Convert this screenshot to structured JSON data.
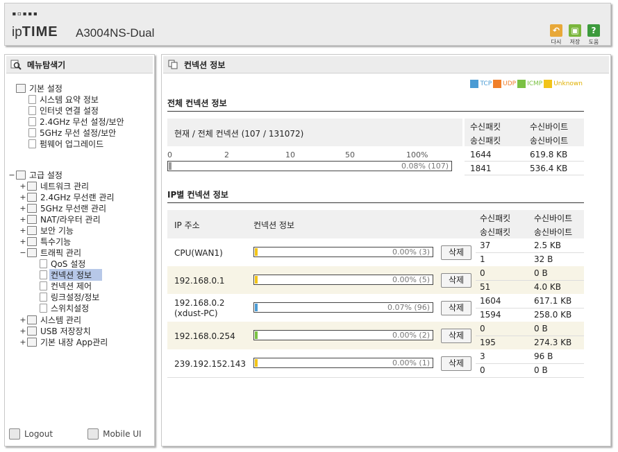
{
  "header": {
    "logo_dots": "▪▫▪▪▪",
    "brand_prefix": "ip",
    "brand_bold": "TIME",
    "model": "A3004NS-Dual",
    "buttons": [
      {
        "label": "다시",
        "icon": "undo-icon",
        "color": "#e8a838",
        "glyph": "↶"
      },
      {
        "label": "저장",
        "icon": "save-icon",
        "color": "#7ab63c",
        "glyph": "▣"
      },
      {
        "label": "도움",
        "icon": "help-icon",
        "color": "#3c9a3c",
        "glyph": "?"
      }
    ]
  },
  "sidebar": {
    "title": "메뉴탐색기",
    "basic": {
      "label": "기본 설정",
      "items": [
        "시스템 요약 정보",
        "인터넷 연결 설정",
        "2.4GHz 무선 설정/보안",
        "5GHz 무선 설정/보안",
        "펌웨어 업그레이드"
      ]
    },
    "advanced": {
      "label": "고급 설정",
      "items": [
        "네트워크 관리",
        "2.4GHz 무선랜 관리",
        "5GHz 무선랜 관리",
        "NAT/라우터 관리",
        "보안 기능",
        "특수기능",
        "트래픽 관리"
      ],
      "traffic_items": [
        "QoS 설정",
        "컨넥션 정보",
        "컨넥션 제어",
        "링크설정/정보",
        "스위치설정"
      ],
      "rest_items": [
        "시스템 관리",
        "USB 저장장치",
        "기본 내장 App관리"
      ]
    },
    "footer": {
      "logout": "Logout",
      "mobile": "Mobile UI"
    }
  },
  "main": {
    "title": "컨넥션 정보",
    "legend": [
      {
        "label": "TCP",
        "color": "#4a9bd4"
      },
      {
        "label": "UDP",
        "color": "#f07f2a"
      },
      {
        "label": "ICMP",
        "color": "#7ac143"
      },
      {
        "label": "Unknown",
        "color": "#f2c418"
      }
    ],
    "total": {
      "section_title": "전체 컨넥션 정보",
      "label": "현재 / 전체 컨넥션 (107 / 131072)",
      "scale": [
        "0",
        "2",
        "10",
        "50",
        "100%"
      ],
      "bar_text": "0.08% (107)",
      "bar_fraction": 0.0008,
      "col_rx_pkt": "수신패킷",
      "col_tx_pkt": "송신패킷",
      "col_rx_byte": "수신바이트",
      "col_tx_byte": "송신바이트",
      "rx_pkt": "1644",
      "rx_byte": "619.8 KB",
      "tx_pkt": "1841",
      "tx_byte": "536.4 KB"
    },
    "by_ip": {
      "section_title": "IP별 컨넥션 정보",
      "col_ip": "IP 주소",
      "col_conn": "컨넥션 정보",
      "col_rx_pkt": "수신패킷",
      "col_tx_pkt": "송신패킷",
      "col_rx_byte": "수신바이트",
      "col_tx_byte": "송신바이트",
      "delete_label": "삭제",
      "rows": [
        {
          "ip": "CPU(WAN1)",
          "sub": "",
          "bar_text": "0.00% (3)",
          "rx_pkt": "37",
          "rx_byte": "2.5 KB",
          "tx_pkt": "1",
          "tx_byte": "32 B",
          "fill": "#f2c418"
        },
        {
          "ip": "192.168.0.1",
          "sub": "",
          "bar_text": "0.00% (5)",
          "rx_pkt": "0",
          "rx_byte": "0 B",
          "tx_pkt": "51",
          "tx_byte": "4.0 KB",
          "fill": "#f2c418"
        },
        {
          "ip": "192.168.0.2",
          "sub": "(xdust-PC)",
          "bar_text": "0.07% (96)",
          "rx_pkt": "1604",
          "rx_byte": "617.1 KB",
          "tx_pkt": "1594",
          "tx_byte": "258.0 KB",
          "fill": "#4a9bd4"
        },
        {
          "ip": "192.168.0.254",
          "sub": "",
          "bar_text": "0.00% (2)",
          "rx_pkt": "0",
          "rx_byte": "0 B",
          "tx_pkt": "195",
          "tx_byte": "274.3 KB",
          "fill": "#7ac143"
        },
        {
          "ip": "239.192.152.143",
          "sub": "",
          "bar_text": "0.00% (1)",
          "rx_pkt": "3",
          "rx_byte": "96 B",
          "tx_pkt": "0",
          "tx_byte": "0 B",
          "fill": "#f2c418"
        }
      ]
    }
  }
}
